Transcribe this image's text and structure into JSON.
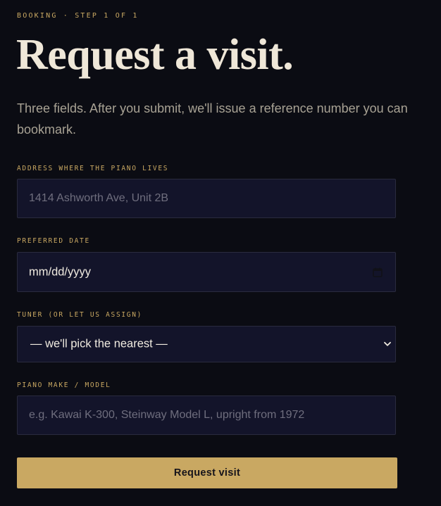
{
  "header": {
    "eyebrow": "BOOKING · STEP 1 OF 1",
    "title": "Request a visit.",
    "lede": "Three fields. After you submit, we'll issue a reference number you can bookmark."
  },
  "form": {
    "address": {
      "label": "ADDRESS WHERE THE PIANO LIVES",
      "placeholder": "1414 Ashworth Ave, Unit 2B"
    },
    "date": {
      "label": "PREFERRED DATE",
      "value": "mm/dd/yyyy",
      "icon": "calendar-icon"
    },
    "tuner": {
      "label": "TUNER (OR LET US ASSIGN)",
      "selected": "— we'll pick the nearest —",
      "icon": "chevron-down-icon"
    },
    "piano": {
      "label": "PIANO MAKE / MODEL",
      "placeholder": "e.g. Kawai K-300, Steinway Model L, upright from 1972"
    },
    "submit_label": "Request visit"
  },
  "colors": {
    "background": "#0b0c13",
    "accent": "#c9a862",
    "field_background": "#13142a",
    "field_border": "#2a2b3e"
  }
}
